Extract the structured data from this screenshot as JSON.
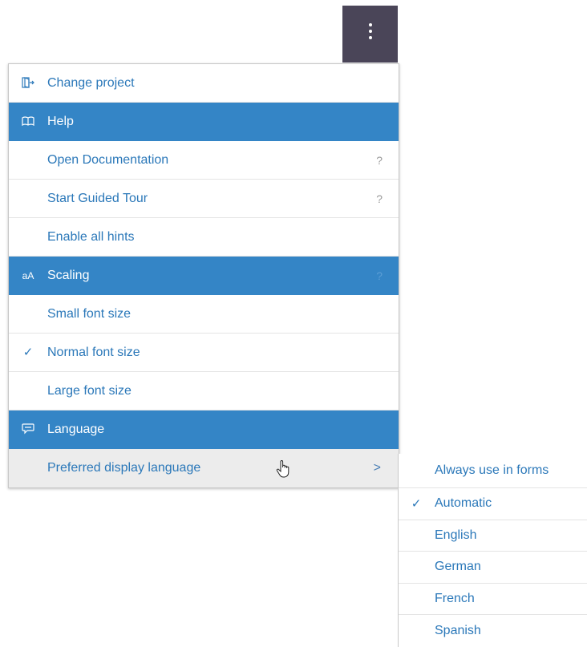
{
  "toolbar": {
    "more_button_icon": "kebab-vertical-icon"
  },
  "menu": {
    "change_project": "Change project",
    "help": {
      "label": "Help",
      "items": [
        "Open Documentation",
        "Start Guided Tour",
        "Enable all hints"
      ]
    },
    "scaling": {
      "label": "Scaling",
      "items": [
        "Small font size",
        "Normal font size",
        "Large font size"
      ],
      "selected": "Normal font size"
    },
    "language": {
      "label": "Language",
      "preferred": "Preferred display language"
    },
    "help_glyph": "?",
    "check_glyph": "✓",
    "chevron_glyph": ">"
  },
  "submenu": {
    "items": [
      "Always use in forms",
      "Automatic",
      "English",
      "German",
      "French",
      "Spanish"
    ],
    "selected": "Automatic"
  },
  "colors": {
    "accent": "#3485c6",
    "text_link": "#2b78b9",
    "toolbar_bg": "#4a4558"
  }
}
